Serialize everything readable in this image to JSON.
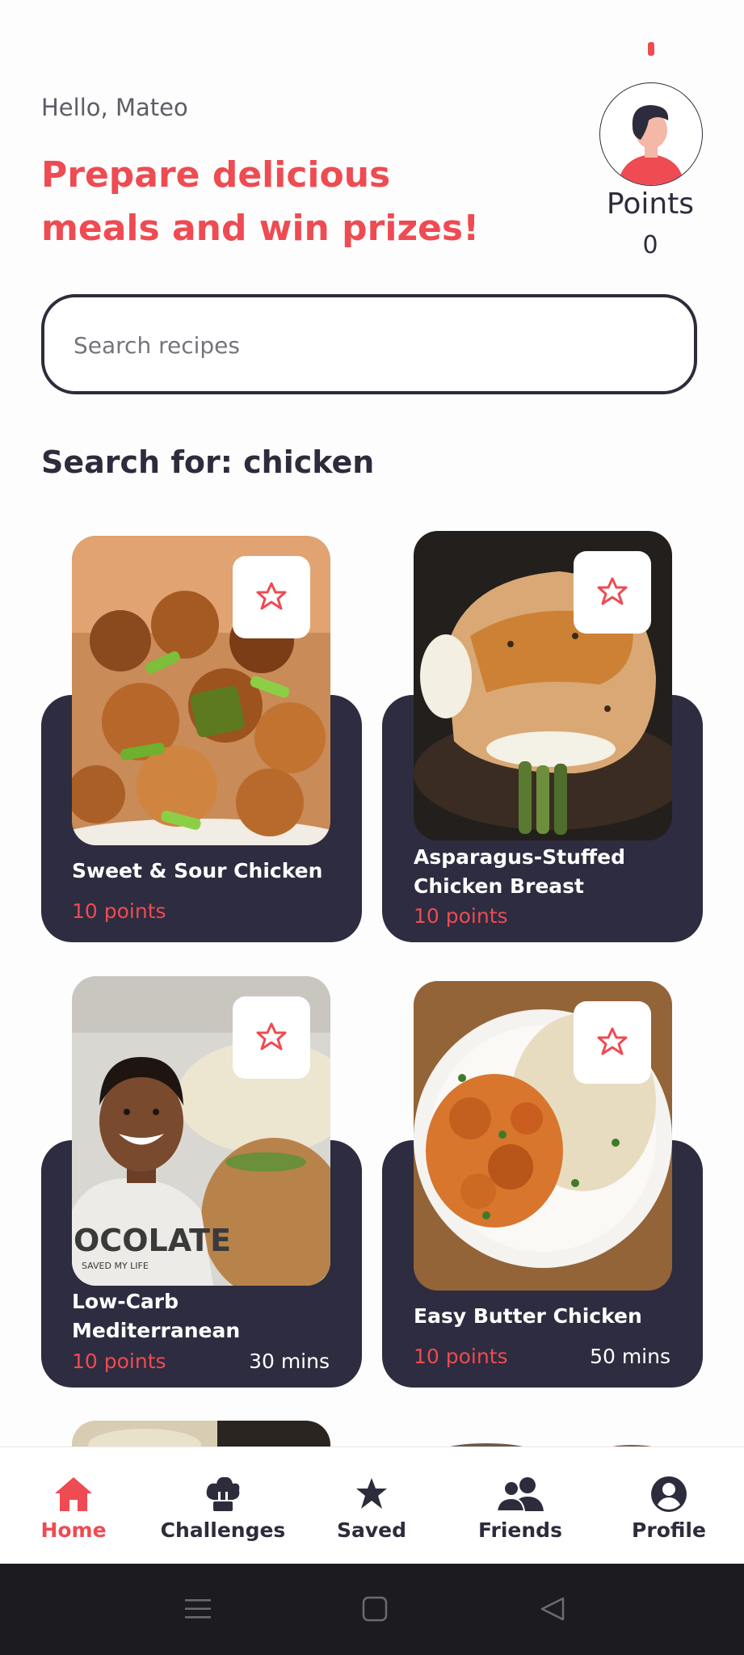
{
  "header": {
    "greeting": "Hello, Mateo",
    "headline": "Prepare delicious meals and win prizes!",
    "points_label": "Points",
    "points_value": "0"
  },
  "search": {
    "placeholder": "Search recipes",
    "value": ""
  },
  "section_title": "Search for: chicken",
  "recipes": [
    {
      "title": "Sweet & Sour Chicken",
      "points": "10 points",
      "time": ""
    },
    {
      "title": "Asparagus-Stuffed Chicken Breast",
      "points": "10 points",
      "time": ""
    },
    {
      "title": "Low-Carb Mediterranean Chicken And Tomato By",
      "points": "10 points",
      "time": "30 mins"
    },
    {
      "title": "Easy Butter Chicken",
      "points": "10 points",
      "time": "50 mins"
    }
  ],
  "tabs": [
    {
      "label": "Home",
      "icon": "home-icon",
      "active": true
    },
    {
      "label": "Challenges",
      "icon": "chef-hat-icon",
      "active": false
    },
    {
      "label": "Saved",
      "icon": "star-icon",
      "active": false
    },
    {
      "label": "Friends",
      "icon": "friends-icon",
      "active": false
    },
    {
      "label": "Profile",
      "icon": "profile-icon",
      "active": false
    }
  ],
  "colors": {
    "accent": "#ee4b52",
    "dark": "#2d2c40",
    "text": "#2d2c3c",
    "navbar": "#1c1b1f"
  }
}
